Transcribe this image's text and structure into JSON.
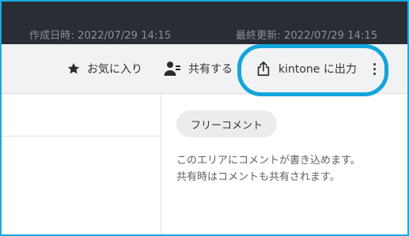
{
  "header": {
    "created": "作成日時: 2022/07/29 14:15",
    "updated": "最終更新: 2022/07/29 14:15"
  },
  "toolbar": {
    "favorite_label": "お気に入り",
    "share_label": "共有する",
    "kintone_export_label": "kintone に出力"
  },
  "comment": {
    "chip_label": "フリーコメント",
    "text_line1": "このエリアにコメントが書き込めます。",
    "text_line2": "共有時はコメントも共有されます。"
  },
  "colors": {
    "header_bg": "#2a2d33",
    "highlight": "#12a4dc",
    "frame": "#1aa9e0"
  },
  "icons": [
    "star-icon",
    "person-share-icon",
    "upload-icon",
    "more-vertical-icon"
  ]
}
